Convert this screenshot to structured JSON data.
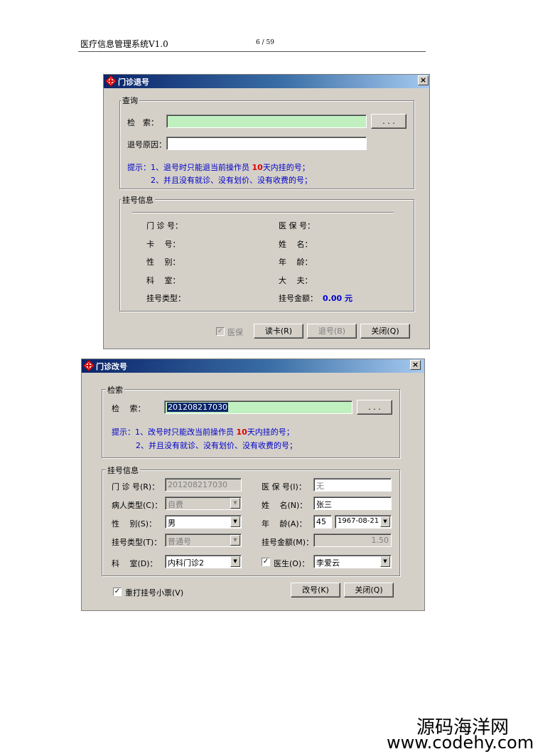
{
  "doc_header": {
    "title": "医疗信息管理系统V1.0",
    "page": "6 / 59"
  },
  "dialog1": {
    "title": "门诊退号",
    "query_group": "查询",
    "search_label": "检　索：",
    "search_value": "",
    "browse_btn": ". . .",
    "reason_label": "退号原因：",
    "reason_value": "",
    "hint_prefix": "提示：1、退号时只能退当前操作员 ",
    "hint_days": "10",
    "hint_suffix": "天内挂的号；",
    "hint2": "2、并且没有就诊、没有划价、没有收费的号；",
    "info_group": "挂号信息",
    "labels": {
      "clinic_no": "门 诊 号：",
      "insurance_no": "医 保 号：",
      "card_no": "卡　 号：",
      "name": "姓　 名：",
      "gender": "性　 别：",
      "age": "年　 龄：",
      "dept": "科　 室：",
      "doctor": "大　 夫：",
      "reg_type": "挂号类型：",
      "reg_amount": "挂号金额："
    },
    "amount_value": "0.00 元",
    "insurance_chk": "医保",
    "read_card_btn": "读卡(R)",
    "refund_btn": "退号(B)",
    "close_btn": "关闭(Q)"
  },
  "dialog2": {
    "title": "门诊改号",
    "search_group": "检索",
    "search_label": "检　 索：",
    "search_value": "201208217030",
    "browse_btn": ". . .",
    "hint_prefix": "提示：1、改号时只能改当前操作员 ",
    "hint_days": "10",
    "hint_suffix": "天内挂的号；",
    "hint2": "2、并且没有就诊、没有划价、没有收费的号；",
    "info_group": "挂号信息",
    "labels": {
      "clinic_no": "门 诊 号(R)：",
      "insurance_no": "医 保 号(I)：",
      "patient_type": "病人类型(C)：",
      "name": "姓　 名(N)：",
      "gender": "性　 别(S)：",
      "age": "年　 龄(A)：",
      "reg_type": "挂号类型(T)：",
      "reg_amount": "挂号金额(M)：",
      "dept": "科　 室(D)：",
      "doctor": "医生(O)："
    },
    "values": {
      "clinic_no": "201208217030",
      "insurance_no": "无",
      "patient_type": "自费",
      "name": "张三",
      "gender": "男",
      "age": "45",
      "birth_date": "1967-08-21",
      "reg_type": "普通号",
      "reg_amount": "1.50",
      "dept": "内科门诊2",
      "doctor": "李爱云"
    },
    "reprint_chk": "重打挂号小票(V)",
    "change_btn": "改号(K)",
    "close_btn": "关闭(Q)"
  },
  "watermark": {
    "line1": "源码海洋网",
    "line2": "www.codehy.com"
  }
}
